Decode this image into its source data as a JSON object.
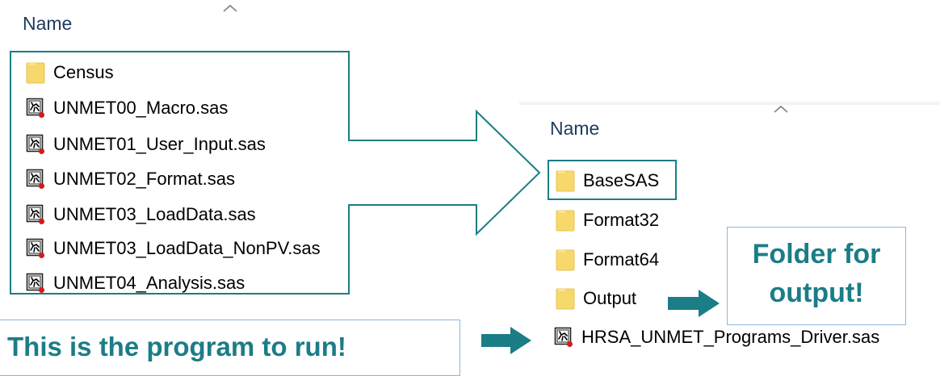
{
  "left_pane": {
    "column_header": "Name",
    "items": [
      {
        "type": "folder",
        "name": "Census"
      },
      {
        "type": "sas",
        "name": "UNMET00_Macro.sas"
      },
      {
        "type": "sas",
        "name": "UNMET01_User_Input.sas"
      },
      {
        "type": "sas",
        "name": "UNMET02_Format.sas"
      },
      {
        "type": "sas",
        "name": "UNMET03_LoadData.sas"
      },
      {
        "type": "sas",
        "name": "UNMET03_LoadData_NonPV.sas"
      },
      {
        "type": "sas",
        "name": "UNMET04_Analysis.sas"
      }
    ]
  },
  "right_pane": {
    "column_header": "Name",
    "items": [
      {
        "type": "folder",
        "name": "BaseSAS"
      },
      {
        "type": "folder",
        "name": "Format32"
      },
      {
        "type": "folder",
        "name": "Format64"
      },
      {
        "type": "folder",
        "name": "Output"
      },
      {
        "type": "sas",
        "name": "HRSA_UNMET_Programs_Driver.sas"
      }
    ]
  },
  "callouts": {
    "output_note_line1": "Folder for",
    "output_note_line2": "output!",
    "run_note": "This is the program to run!"
  },
  "colors": {
    "accent": "#1b7d86",
    "folder": "#f6d86b",
    "header_text": "#1e3a5f"
  }
}
